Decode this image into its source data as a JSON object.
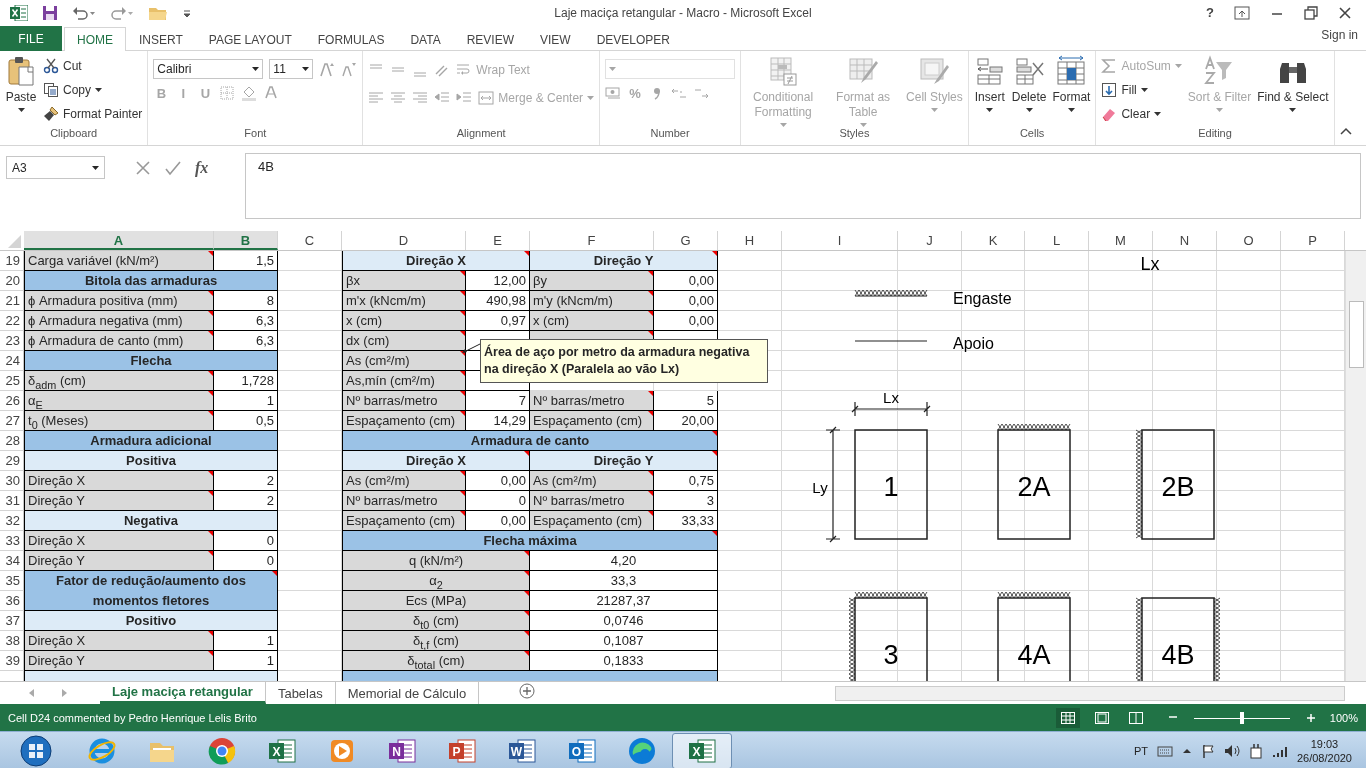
{
  "window": {
    "title": "Laje maciça retangular - Macro - Microsoft Excel",
    "help": "?"
  },
  "tabs": [
    {
      "label": "FILE",
      "kind": "file",
      "selected": false
    },
    {
      "label": "HOME",
      "kind": "tab",
      "selected": true
    },
    {
      "label": "INSERT",
      "kind": "tab",
      "selected": false
    },
    {
      "label": "PAGE LAYOUT",
      "kind": "tab",
      "selected": false
    },
    {
      "label": "FORMULAS",
      "kind": "tab",
      "selected": false
    },
    {
      "label": "DATA",
      "kind": "tab",
      "selected": false
    },
    {
      "label": "REVIEW",
      "kind": "tab",
      "selected": false
    },
    {
      "label": "VIEW",
      "kind": "tab",
      "selected": false
    },
    {
      "label": "DEVELOPER",
      "kind": "tab",
      "selected": false
    }
  ],
  "sign_in": "Sign in",
  "ribbon": [
    {
      "label": "Clipboard",
      "parts": [
        [
          {
            "kind": "large",
            "label": "Paste",
            "caret": true,
            "disabled": false
          }
        ],
        [
          {
            "kind": "small",
            "label": "Cut",
            "caret": false,
            "disabled": false
          },
          {
            "kind": "small",
            "label": "Copy",
            "caret": true,
            "disabled": false
          },
          {
            "kind": "small",
            "label": "Format Painter",
            "caret": false,
            "disabled": false
          }
        ]
      ]
    },
    {
      "label": "Font",
      "parts": [
        [
          {
            "kind": "field",
            "value": "Calibri",
            "disabled": false
          },
          {
            "kind": "field",
            "value": "11",
            "disabled": false
          },
          {
            "kind": "icon",
            "disabled": true
          },
          {
            "kind": "icon",
            "disabled": true
          }
        ],
        [
          {
            "kind": "text",
            "label": "B",
            "disabled": true
          },
          {
            "kind": "text",
            "label": "I",
            "disabled": true
          },
          {
            "kind": "text",
            "label": "U",
            "disabled": true
          },
          {
            "kind": "icon",
            "disabled": true
          },
          {
            "kind": "icon",
            "disabled": true
          },
          {
            "kind": "icon",
            "disabled": true
          }
        ]
      ]
    },
    {
      "label": "Alignment",
      "parts": [
        [
          {
            "kind": "icon",
            "disabled": true
          },
          {
            "kind": "icon",
            "disabled": true
          },
          {
            "kind": "icon",
            "disabled": true
          },
          {
            "kind": "icon",
            "disabled": true
          },
          {
            "kind": "small",
            "label": "Wrap Text",
            "caret": false,
            "disabled": true
          }
        ],
        [
          {
            "kind": "icon",
            "disabled": true
          },
          {
            "kind": "icon",
            "disabled": true
          },
          {
            "kind": "icon",
            "disabled": true
          },
          {
            "kind": "icon",
            "disabled": true
          },
          {
            "kind": "icon",
            "disabled": true
          },
          {
            "kind": "small",
            "label": "Merge & Center",
            "caret": true,
            "disabled": true
          }
        ]
      ]
    },
    {
      "label": "Number",
      "parts": [
        [
          {
            "kind": "field",
            "disabled": true
          }
        ],
        [
          {
            "kind": "icon",
            "disabled": true
          },
          {
            "kind": "text",
            "label": "%",
            "disabled": true
          },
          {
            "kind": "icon",
            "disabled": true
          },
          {
            "kind": "icon",
            "disabled": true
          },
          {
            "kind": "icon",
            "disabled": true
          }
        ]
      ]
    },
    {
      "label": "Styles",
      "parts": [
        [
          {
            "kind": "large",
            "label": "Conditional Formatting",
            "caret": true,
            "disabled": true
          }
        ],
        [
          {
            "kind": "large",
            "label": "Format as Table",
            "caret": true,
            "disabled": true
          }
        ],
        [
          {
            "kind": "large",
            "label": "Cell Styles",
            "caret": true,
            "disabled": true
          }
        ]
      ]
    },
    {
      "label": "Cells",
      "parts": [
        [
          {
            "kind": "large",
            "label": "Insert",
            "caret": true,
            "disabled": false
          }
        ],
        [
          {
            "kind": "large",
            "label": "Delete",
            "caret": true,
            "disabled": false
          }
        ],
        [
          {
            "kind": "large",
            "label": "Format",
            "caret": true,
            "disabled": false
          }
        ]
      ]
    },
    {
      "label": "Editing",
      "parts": [
        [
          {
            "kind": "small",
            "label": "AutoSum",
            "caret": true,
            "disabled": true
          },
          {
            "kind": "small",
            "label": "Fill",
            "caret": true,
            "disabled": false
          },
          {
            "kind": "small",
            "label": "Clear",
            "caret": true,
            "disabled": false
          }
        ],
        [
          {
            "kind": "large",
            "label": "Sort & Filter",
            "caret": true,
            "disabled": true
          }
        ],
        [
          {
            "kind": "large",
            "label": "Find & Select",
            "caret": true,
            "disabled": false
          }
        ]
      ]
    }
  ],
  "formula_bar": {
    "name_box": "A3",
    "function_label": "fx",
    "content": "4B"
  },
  "columns": [
    {
      "label": "A",
      "selected": true
    },
    {
      "label": "B",
      "selected": true
    },
    {
      "label": "C",
      "selected": false
    },
    {
      "label": "D",
      "selected": false
    },
    {
      "label": "E",
      "selected": false
    },
    {
      "label": "F",
      "selected": false
    },
    {
      "label": "G",
      "selected": false
    },
    {
      "label": "H",
      "selected": false
    },
    {
      "label": "I",
      "selected": false
    },
    {
      "label": "J",
      "selected": false
    },
    {
      "label": "K",
      "selected": false
    },
    {
      "label": "L",
      "selected": false
    },
    {
      "label": "M",
      "selected": false
    },
    {
      "label": "N",
      "selected": false
    },
    {
      "label": "O",
      "selected": false
    },
    {
      "label": "P",
      "selected": false
    }
  ],
  "rows": [
    {
      "number": "19",
      "left": {
        "kind": "pair",
        "label": "Carga variável (kN/m²)",
        "value": "1,5",
        "comment": true
      },
      "middle": {
        "kind": "split_sub",
        "cells": [
          {
            "text": "Direção X",
            "comment": true
          },
          {
            "text": "Direção Y",
            "comment": true
          }
        ]
      }
    },
    {
      "number": "20",
      "left": {
        "kind": "head",
        "text": "Bitola das armaduras",
        "comment": false
      },
      "middle": {
        "kind": "pairs",
        "items": [
          {
            "label": "βx",
            "value": "12,00",
            "comment": true
          },
          {
            "label": "βy",
            "value": "0,00",
            "comment": true
          }
        ]
      }
    },
    {
      "number": "21",
      "left": {
        "kind": "pair",
        "label": "ϕ Armadura positiva (mm)",
        "value": "8",
        "comment": true
      },
      "middle": {
        "kind": "pairs",
        "items": [
          {
            "label": "m'x (kNcm/m)",
            "value": "490,98",
            "comment": true
          },
          {
            "label": "m'y (kNcm/m)",
            "value": "0,00",
            "comment": true
          }
        ]
      }
    },
    {
      "number": "22",
      "left": {
        "kind": "pair",
        "label": "ϕ Armadura negativa (mm)",
        "value": "6,3",
        "comment": true
      },
      "middle": {
        "kind": "pairs",
        "items": [
          {
            "label": "x (cm)",
            "value": "0,97",
            "comment": true
          },
          {
            "label": "x (cm)",
            "value": "0,00",
            "comment": true
          }
        ]
      }
    },
    {
      "number": "23",
      "left": {
        "kind": "pair",
        "label": "ϕ Armadura de canto (mm)",
        "value": "6,3",
        "comment": true
      },
      "middle": {
        "kind": "pairs",
        "items": [
          {
            "label": "dx (cm)",
            "comment": true
          },
          {
            "comment": true
          }
        ]
      }
    },
    {
      "number": "24",
      "left": {
        "kind": "head",
        "text": "Flecha",
        "comment": false
      },
      "middle": {
        "kind": "pairs",
        "items": [
          {
            "label": "As (cm²/m)",
            "comment": true
          }
        ]
      }
    },
    {
      "number": "25",
      "left": {
        "kind": "pair",
        "label": "δ$_{adm}$ (cm)",
        "value": "1,728",
        "comment": true
      },
      "middle": {
        "kind": "pairs",
        "items": [
          {
            "label": "As,mín (cm²/m)",
            "comment": true
          }
        ]
      }
    },
    {
      "number": "26",
      "left": {
        "kind": "pair",
        "label": "α$_{E}$",
        "value": "1",
        "comment": true
      },
      "middle": {
        "kind": "pairs",
        "items": [
          {
            "label": "Nº barras/metro",
            "value": "7",
            "comment": true
          },
          {
            "label": "Nº barras/metro",
            "value": "5",
            "comment": true
          }
        ]
      }
    },
    {
      "number": "27",
      "left": {
        "kind": "pair",
        "label": "t$_{0}$ (Meses)",
        "value": "0,5",
        "comment": true
      },
      "middle": {
        "kind": "pairs",
        "items": [
          {
            "label": "Espaçamento (cm)",
            "value": "14,29",
            "comment": true
          },
          {
            "label": "Espaçamento (cm)",
            "value": "20,00",
            "comment": true
          }
        ]
      }
    },
    {
      "number": "28",
      "left": {
        "kind": "head",
        "text": "Armadura adicional",
        "comment": false
      },
      "middle": {
        "kind": "full_head",
        "text": "Armadura de canto",
        "comment": true
      }
    },
    {
      "number": "29",
      "left": {
        "kind": "sub",
        "text": "Positiva",
        "comment": false
      },
      "middle": {
        "kind": "split_sub",
        "cells": [
          {
            "text": "Direção X",
            "comment": true
          },
          {
            "text": "Direção Y",
            "comment": true
          }
        ]
      }
    },
    {
      "number": "30",
      "left": {
        "kind": "pair",
        "label": "Direção X",
        "value": "2",
        "comment": true
      },
      "middle": {
        "kind": "pairs",
        "items": [
          {
            "label": "As (cm²/m)",
            "value": "0,00",
            "comment": true
          },
          {
            "label": "As (cm²/m)",
            "value": "0,75",
            "comment": true
          }
        ]
      }
    },
    {
      "number": "31",
      "left": {
        "kind": "pair",
        "label": "Direção Y",
        "value": "2",
        "comment": true
      },
      "middle": {
        "kind": "pairs",
        "items": [
          {
            "label": "Nº barras/metro",
            "value": "0",
            "comment": true
          },
          {
            "label": "Nº barras/metro",
            "value": "3",
            "comment": true
          }
        ]
      }
    },
    {
      "number": "32",
      "left": {
        "kind": "sub",
        "text": "Negativa",
        "comment": false
      },
      "middle": {
        "kind": "pairs",
        "items": [
          {
            "label": "Espaçamento (cm)",
            "value": "0,00",
            "comment": true
          },
          {
            "label": "Espaçamento (cm)",
            "value": "33,33",
            "comment": true
          }
        ]
      }
    },
    {
      "number": "33",
      "left": {
        "kind": "pair",
        "label": "Direção X",
        "value": "0",
        "comment": true
      },
      "middle": {
        "kind": "full_head",
        "text": "Flecha máxima",
        "comment": true
      }
    },
    {
      "number": "34",
      "left": {
        "kind": "pair",
        "label": "Direção Y",
        "value": "0",
        "comment": true
      },
      "middle": {
        "kind": "center_pair",
        "label": "q (kN/m²)",
        "value": "4,20",
        "comment": true
      }
    },
    {
      "number": "35",
      "left": {
        "kind": "head_tall",
        "text": "Fator de redução/aumento dos momentos fletores",
        "comment": true
      },
      "middle": {
        "kind": "center_pair",
        "label": "α$_{2}$",
        "value": "33,3",
        "comment": true
      }
    },
    {
      "number": "36",
      "middle": {
        "kind": "center_pair",
        "label": "Ecs (MPa)",
        "value": "21287,37",
        "comment": true
      }
    },
    {
      "number": "37",
      "left": {
        "kind": "sub",
        "text": "Positivo",
        "comment": false
      },
      "middle": {
        "kind": "center_pair",
        "label": "δ$_{t0}$ (cm)",
        "value": "0,0746",
        "comment": true
      }
    },
    {
      "number": "38",
      "left": {
        "kind": "pair",
        "label": "Direção X",
        "value": "1",
        "comment": true
      },
      "middle": {
        "kind": "center_pair",
        "label": "δ$_{t,f}$ (cm)",
        "value": "0,1087",
        "comment": true
      }
    },
    {
      "number": "39",
      "left": {
        "kind": "pair",
        "label": "Direção Y",
        "value": "1",
        "comment": true
      },
      "middle": {
        "kind": "center_pair",
        "label": "δ$_{total}$ (cm)",
        "value": "0,1833",
        "comment": true
      }
    },
    {
      "left": {
        "kind": "sub",
        "comment": false
      },
      "middle": {
        "kind": "full_head",
        "comment": false
      }
    }
  ],
  "comment_box": {
    "text": "Área de aço por metro da armadura negativa na direção X (Paralela ao vão Lx)"
  },
  "drawing": {
    "top_label": "Lx",
    "legend": [
      {
        "kind": "fixed",
        "label": "Engaste"
      },
      {
        "kind": "support",
        "label": "Apoio"
      }
    ],
    "dimensions": {
      "x": "Lx",
      "y": "Ly"
    },
    "slabs": [
      {
        "label": "1",
        "fixed_top": false,
        "fixed_left": false,
        "fixed_right": false
      },
      {
        "label": "2A",
        "fixed_top": true,
        "fixed_left": false,
        "fixed_right": false
      },
      {
        "label": "2B",
        "fixed_top": false,
        "fixed_left": true,
        "fixed_right": false
      },
      {
        "label": "3",
        "fixed_top": true,
        "fixed_left": true,
        "fixed_right": false
      },
      {
        "label": "4A",
        "fixed_top": true,
        "fixed_left": false,
        "fixed_right": false
      },
      {
        "label": "4B",
        "fixed_top": false,
        "fixed_left": true,
        "fixed_right": true
      }
    ]
  },
  "sheet_tabs": [
    {
      "label": "Laje maciça retangular",
      "selected": true
    },
    {
      "label": "Tabelas",
      "selected": false
    },
    {
      "label": "Memorial de Cálculo",
      "selected": false
    }
  ],
  "status_bar": {
    "text": "Cell D24 commented by Pedro Henrique Lelis Brito",
    "views": [
      {
        "selected": true
      },
      {
        "selected": false
      },
      {
        "selected": false
      }
    ],
    "zoom": {
      "level": 0.5,
      "reading": "100%"
    }
  },
  "taskbar": {
    "apps": [
      {
        "kind": "ie",
        "active": false
      },
      {
        "kind": "folder",
        "active": false
      },
      {
        "kind": "chrome",
        "active": false
      },
      {
        "kind": "office",
        "letter": "X",
        "color": "#1e7145",
        "active": false
      },
      {
        "kind": "media",
        "active": false
      },
      {
        "kind": "office",
        "letter": "N",
        "color": "#7b2e9b",
        "active": false
      },
      {
        "kind": "office",
        "letter": "P",
        "color": "#c4402b",
        "active": false
      },
      {
        "kind": "office",
        "letter": "W",
        "color": "#2b5797",
        "active": false
      },
      {
        "kind": "office",
        "letter": "O",
        "color": "#0f6cbd",
        "active": false
      },
      {
        "kind": "edge",
        "active": false
      },
      {
        "kind": "office",
        "letter": "X",
        "color": "#1e7145",
        "active": true
      }
    ],
    "language": "PT",
    "time": "19:03",
    "date": "26/08/2020"
  }
}
